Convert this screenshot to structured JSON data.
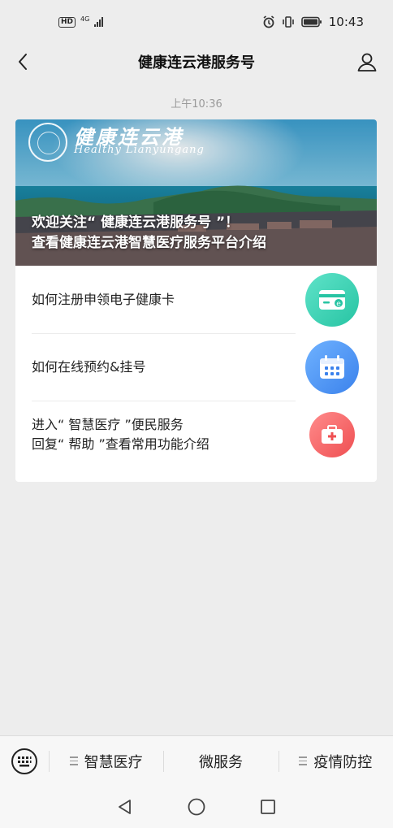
{
  "status_bar": {
    "hd": "HD",
    "network": "4G",
    "time": "10:43"
  },
  "nav": {
    "title": "健康连云港服务号"
  },
  "timestamp": "上午10:36",
  "banner": {
    "logo_text": "健康连云港",
    "logo_sub": "Healthy Lianyungang",
    "caption_line1": "欢迎关注“ 健康连云港服务号 ”！",
    "caption_line2": "查看健康连云港智慧医疗服务平台介绍"
  },
  "menu_items": [
    {
      "line1": "如何注册申领电子健康卡",
      "line2": "",
      "icon": "health-card-icon",
      "color": "#2fcbaa"
    },
    {
      "line1": "如何在线预约&挂号",
      "line2": "",
      "icon": "calendar-icon",
      "color": "#4a8ff0"
    },
    {
      "line1": "进入“ 智慧医疗 ”便民服务",
      "line2": "回复“ 帮助 ”查看常用功能介绍",
      "icon": "medical-kit-icon",
      "color": "#f05a5c"
    }
  ],
  "bottom_menu": [
    {
      "label": "智慧医疗",
      "has_submenu": true
    },
    {
      "label": "微服务",
      "has_submenu": false
    },
    {
      "label": "疫情防控",
      "has_submenu": true
    }
  ],
  "colors": {
    "background": "#ededed",
    "card": "#ffffff",
    "teal": "#2fcbaa",
    "blue": "#4a8ff0",
    "red": "#f05a5c"
  }
}
